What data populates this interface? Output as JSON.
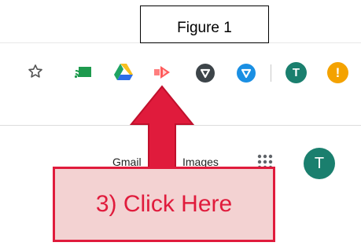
{
  "figure_label": "Figure 1",
  "browser_toolbar": {
    "icons": {
      "bookmark": "star-icon",
      "cast": "cast-icon",
      "drive": "google-drive-icon",
      "extension_red": "red-arrow-extension-icon",
      "extension_dark": "dark-shield-extension-icon",
      "extension_blue": "blue-shield-extension-icon",
      "alert": "alert-icon"
    },
    "profile_initial": "T",
    "alert_symbol": "!"
  },
  "google_header": {
    "gmail_label": "Gmail",
    "images_label": "Images",
    "apps_icon": "grid-apps-icon",
    "account_initial": "T"
  },
  "callout": {
    "text": "3) Click Here"
  },
  "colors": {
    "callout_red": "#e01b3c",
    "callout_fill": "#f3d2d2",
    "avatar_teal": "#1a7f6e",
    "alert_orange": "#f4a200"
  }
}
